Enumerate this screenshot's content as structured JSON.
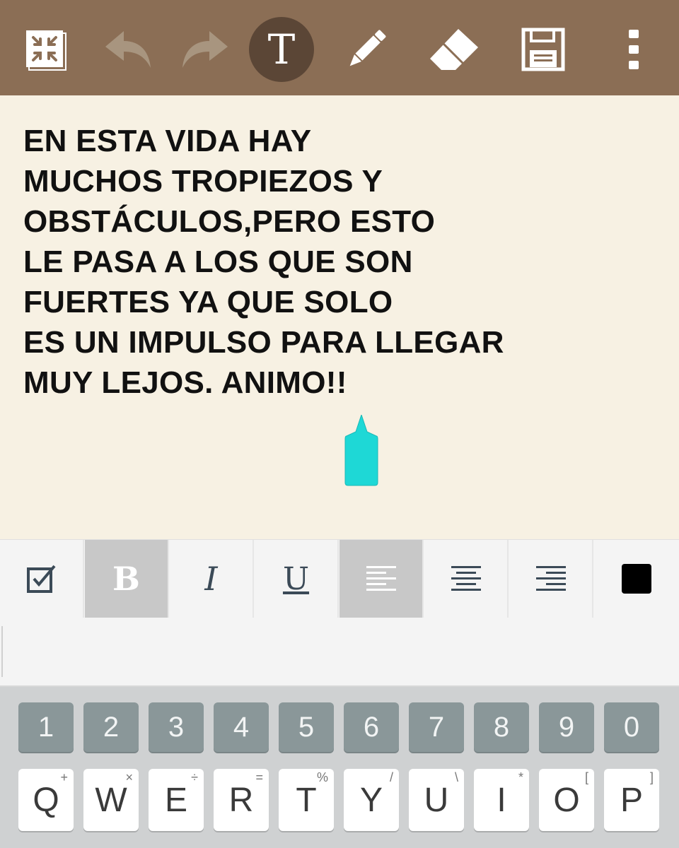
{
  "toolbar": {
    "buttons": [
      {
        "id": "minimize",
        "icon": "collapse-icon"
      },
      {
        "id": "undo",
        "icon": "undo-icon"
      },
      {
        "id": "redo",
        "icon": "redo-icon"
      },
      {
        "id": "text",
        "icon": "text-tool-icon",
        "label": "T",
        "active": true
      },
      {
        "id": "pen",
        "icon": "pen-icon"
      },
      {
        "id": "eraser",
        "icon": "eraser-icon"
      },
      {
        "id": "save",
        "icon": "save-icon"
      },
      {
        "id": "more",
        "icon": "more-vert-icon"
      }
    ],
    "bg_color": "#8b6e55"
  },
  "note": {
    "lines": [
      "EN ESTA VIDA HAY",
      "MUCHOS TROPIEZOS Y",
      "OBSTÁCULOS,PERO ESTO",
      "LE PASA A LOS QUE SON",
      "FUERTES YA QUE SOLO",
      "ES UN IMPULSO PARA LLEGAR",
      "MUY LEJOS. ANIMO!!"
    ],
    "handle_color": "#1ed8d6"
  },
  "format_bar": {
    "bold": "B",
    "italic": "I",
    "underline": "U",
    "selected": [
      "bold",
      "align-left"
    ],
    "text_color": "#000000"
  },
  "keyboard": {
    "numbers": [
      "1",
      "2",
      "3",
      "4",
      "5",
      "6",
      "7",
      "8",
      "9",
      "0"
    ],
    "letters": [
      {
        "key": "Q",
        "sup": "+"
      },
      {
        "key": "W",
        "sup": "×"
      },
      {
        "key": "E",
        "sup": "÷"
      },
      {
        "key": "R",
        "sup": "="
      },
      {
        "key": "T",
        "sup": "%"
      },
      {
        "key": "Y",
        "sup": "/"
      },
      {
        "key": "U",
        "sup": "\\"
      },
      {
        "key": "I",
        "sup": "*"
      },
      {
        "key": "O",
        "sup": "["
      },
      {
        "key": "P",
        "sup": "]"
      }
    ]
  }
}
